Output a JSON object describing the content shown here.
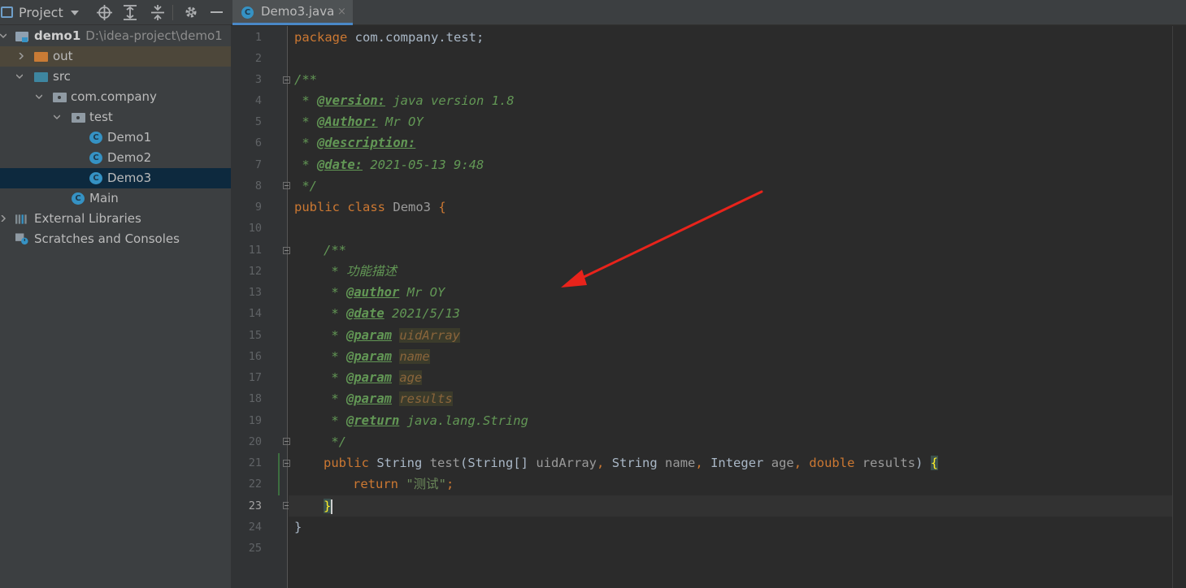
{
  "project_panel": {
    "title": "Project",
    "tree": [
      {
        "label": "demo1",
        "path": "D:\\idea-project\\demo1"
      },
      {
        "label": "out"
      },
      {
        "label": "src"
      },
      {
        "label": "com.company"
      },
      {
        "label": "test"
      },
      {
        "label": "Demo1"
      },
      {
        "label": "Demo2"
      },
      {
        "label": "Demo3"
      },
      {
        "label": "Main"
      },
      {
        "label": "External Libraries"
      },
      {
        "label": "Scratches and Consoles"
      }
    ]
  },
  "editor": {
    "tab": {
      "label": "Demo3.java",
      "close": "×"
    },
    "line_numbers": [
      "1",
      "2",
      "3",
      "4",
      "5",
      "6",
      "7",
      "8",
      "9",
      "10",
      "11",
      "12",
      "13",
      "14",
      "15",
      "16",
      "17",
      "18",
      "19",
      "20",
      "21",
      "22",
      "23",
      "24",
      "25"
    ],
    "code": {
      "l1_kw": "package",
      "l1_rest": " com.company.test;",
      "l3": "/**",
      "l4_a": " * ",
      "l4_tag": "@version:",
      "l4_b": " java version 1.8",
      "l5_a": " * ",
      "l5_tag": "@Author:",
      "l5_b": " Mr OY",
      "l6_a": " * ",
      "l6_tag": "@description:",
      "l7_a": " * ",
      "l7_tag": "@date:",
      "l7_b": " 2021-05-13 9:48",
      "l8": " */",
      "l9_kw1": "public",
      "l9_kw2": "class",
      "l9_name": "Demo3",
      "l9_brace": "{",
      "l11": "/**",
      "l12": " * 功能描述",
      "l13_a": " * ",
      "l13_tag": "@author",
      "l13_b": " Mr OY",
      "l14_a": " * ",
      "l14_tag": "@date",
      "l14_b": " 2021/5/13",
      "l15_a": " * ",
      "l15_tag": "@param",
      "l15_val": "uidArray",
      "l16_a": " * ",
      "l16_tag": "@param",
      "l16_val": "name",
      "l17_a": " * ",
      "l17_tag": "@param",
      "l17_val": "age",
      "l18_a": " * ",
      "l18_tag": "@param",
      "l18_val": "results",
      "l19_a": " * ",
      "l19_tag": "@return",
      "l19_b": " java.lang.String",
      "l20": " */",
      "l21_kw": "public",
      "l21_t1": "String",
      "l21_m": "test",
      "l21_p0": "(",
      "l21_t2": "String[]",
      "l21_v1": "uidArray",
      "l21_c1": ",",
      "l21_t3": "String",
      "l21_v2": "name",
      "l21_c2": ",",
      "l21_t4": "Integer",
      "l21_v3": "age",
      "l21_c3": ",",
      "l21_kw2": "double",
      "l21_v4": "results",
      "l21_p1": ")",
      "l21_brace": "{",
      "l22_kw": "return",
      "l22_str": "\"测试\"",
      "l22_semi": ";",
      "l23": "}",
      "l24": "}"
    }
  }
}
